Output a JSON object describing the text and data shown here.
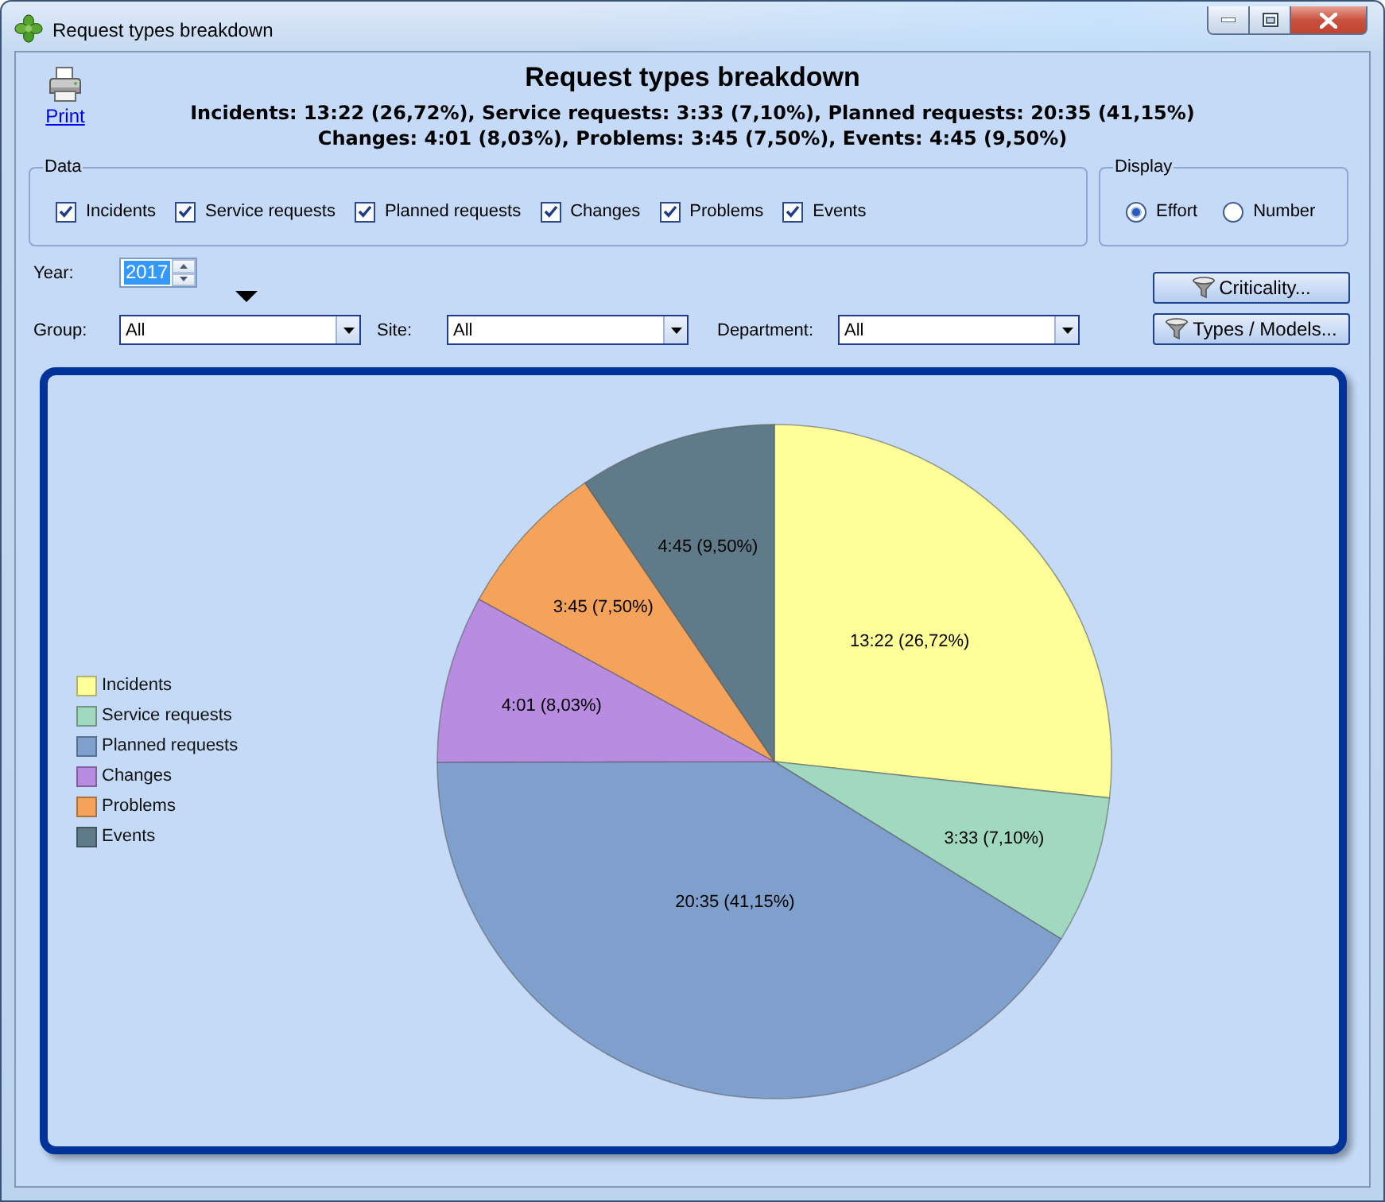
{
  "window": {
    "title": "Request types breakdown"
  },
  "header": {
    "print_link": "Print",
    "title": "Request types breakdown",
    "summary_lines": [
      "Incidents: 13:22 (26,72%), Service requests: 3:33 (7,10%), Planned requests: 20:35 (41,15%)",
      "Changes: 4:01 (8,03%), Problems: 3:45 (7,50%), Events: 4:45 (9,50%)"
    ]
  },
  "data_group": {
    "title": "Data",
    "checkboxes": [
      {
        "label": "Incidents",
        "checked": true
      },
      {
        "label": "Service requests",
        "checked": true
      },
      {
        "label": "Planned requests",
        "checked": true
      },
      {
        "label": "Changes",
        "checked": true
      },
      {
        "label": "Problems",
        "checked": true
      },
      {
        "label": "Events",
        "checked": true
      }
    ]
  },
  "display_group": {
    "title": "Display",
    "options": [
      {
        "label": "Effort",
        "selected": true
      },
      {
        "label": "Number",
        "selected": false
      }
    ]
  },
  "year": {
    "label": "Year:",
    "value": "2017",
    "highlighted": true
  },
  "filters": [
    {
      "label": "Group:",
      "value": "All"
    },
    {
      "label": "Site:",
      "value": "All"
    },
    {
      "label": "Department:",
      "value": "All"
    }
  ],
  "buttons": [
    "Criticality...",
    "Types / Models..."
  ],
  "chart": {
    "chart_data": {
      "type": "pie",
      "categories": [
        "Incidents",
        "Service requests",
        "Planned requests",
        "Changes",
        "Problems",
        "Events"
      ],
      "values": [
        26.72,
        7.1,
        41.15,
        8.03,
        7.5,
        9.5
      ],
      "colors": [
        "#ffff99",
        "#a0d8c0",
        "#7f9fcc",
        "#b88ce0",
        "#f5a35a",
        "#5f7b89"
      ],
      "value_labels": [
        "13:22 (26,72%)",
        "3:33 (7,10%)",
        "20:35 (41,15%)",
        "4:01 (8,03%)",
        "3:45 (7,50%)",
        "4:45 (9,50%)"
      ],
      "legend": true
    }
  }
}
